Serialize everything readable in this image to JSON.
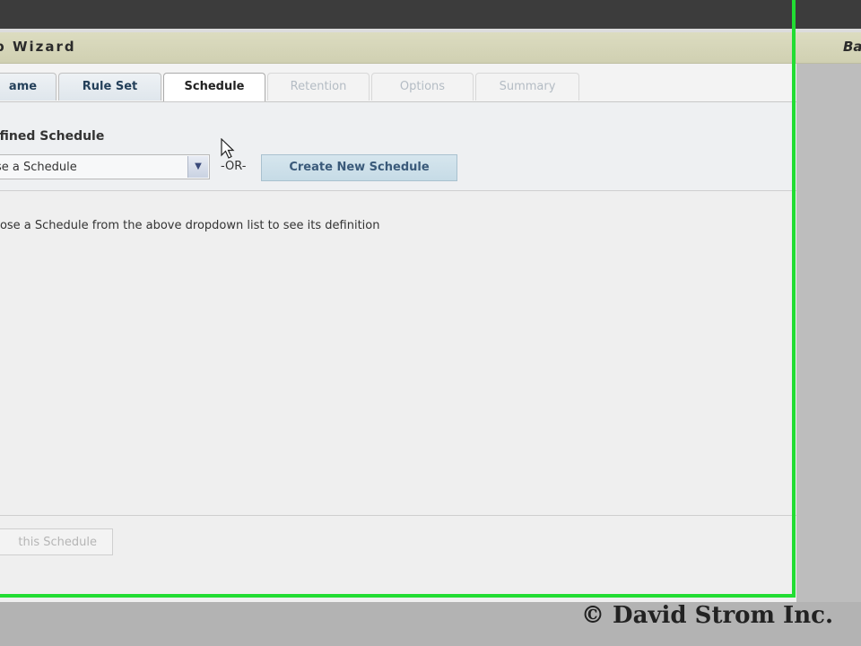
{
  "wizard": {
    "title": "p Wizard",
    "header_right": "Ba"
  },
  "tabs": [
    {
      "label": "ame",
      "state": "normal"
    },
    {
      "label": "Rule Set",
      "state": "normal"
    },
    {
      "label": "Schedule",
      "state": "active"
    },
    {
      "label": "Retention",
      "state": "disabled"
    },
    {
      "label": "Options",
      "state": "disabled"
    },
    {
      "label": "Summary",
      "state": "disabled"
    }
  ],
  "schedule": {
    "predefined_label": "efined Schedule",
    "select_value": "se a Schedule",
    "or_label": "-OR-",
    "create_button": "Create New Schedule",
    "hint": "oose a Schedule from the above dropdown list to see its definition"
  },
  "footer": {
    "button_label": "this Schedule"
  },
  "watermark": {
    "copyright": "© David Strom Inc."
  },
  "colors": {
    "highlight": "#22dd33",
    "primary_button": "#c6dbe6",
    "header_band": "#d0d0b2"
  },
  "icons": {
    "dropdown": "chevron-down-icon",
    "pointer": "mouse-cursor-icon"
  }
}
